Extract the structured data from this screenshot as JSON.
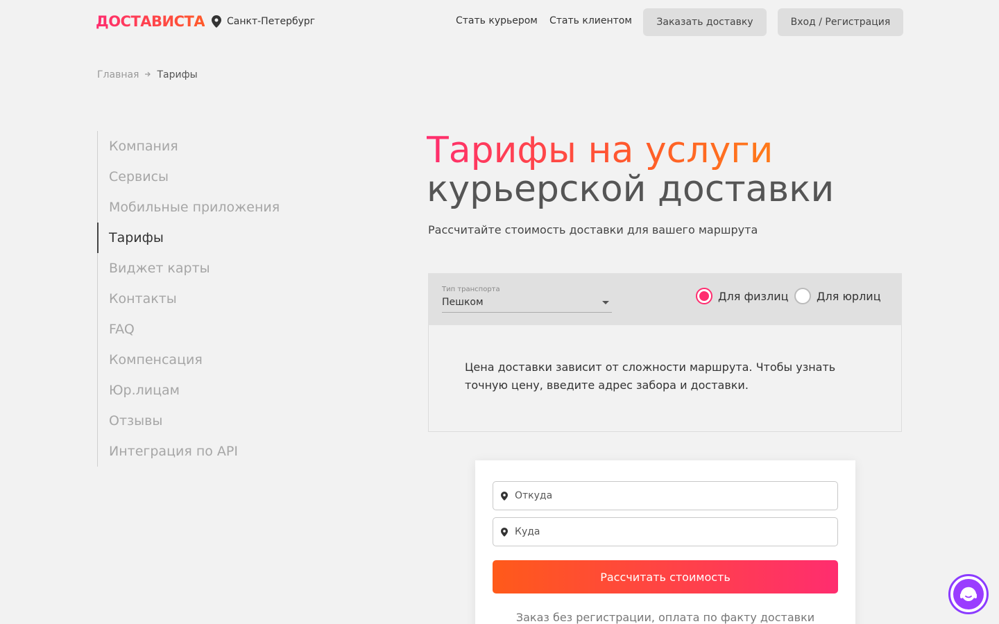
{
  "header": {
    "logo": "ДОСТАВИСТА",
    "city": "Санкт-Петербург",
    "nav": [
      "Стать курьером",
      "Стать клиентом"
    ],
    "order_button": "Заказать доставку",
    "login_button": "Вход / Регистрация"
  },
  "breadcrumb": {
    "home": "Главная",
    "current": "Тарифы"
  },
  "sidebar": {
    "items": [
      {
        "label": "Компания"
      },
      {
        "label": "Сервисы"
      },
      {
        "label": "Мобильные приложения"
      },
      {
        "label": "Тарифы",
        "active": true
      },
      {
        "label": "Виджет карты"
      },
      {
        "label": "Контакты"
      },
      {
        "label": "FAQ"
      },
      {
        "label": "Компенсация"
      },
      {
        "label": "Юр.лицам"
      },
      {
        "label": "Отзывы"
      },
      {
        "label": "Интеграция по API"
      }
    ]
  },
  "main": {
    "title_line1": "Тарифы на услуги",
    "title_line2": "курьерской доставки",
    "subtitle": "Рассчитайте стоимость доставки для вашего маршрута"
  },
  "calculator": {
    "transport_label": "Тип транспорта",
    "transport_value": "Пешком",
    "radio_individual": "Для физлиц",
    "radio_company": "Для юрлиц",
    "selected": "Для физлиц",
    "notice": "Цена доставки зависит от сложности маршрута. Чтобы узнать точную цену, введите адрес забора и доставки."
  },
  "form": {
    "from_placeholder": "Откуда",
    "to_placeholder": "Куда",
    "button": "Рассчитать стоимость",
    "note": "Заказ без регистрации, оплата по факту доставки"
  },
  "colors": {
    "brand_pink": "#ff2d6f",
    "brand_orange": "#ff5a1a",
    "support_purple": "#8b3bff"
  },
  "icons": {
    "city": "location-pin-icon",
    "address": "location-pin-icon",
    "breadcrumb_separator": "arrow-right-icon",
    "support": "support-headset-icon"
  }
}
